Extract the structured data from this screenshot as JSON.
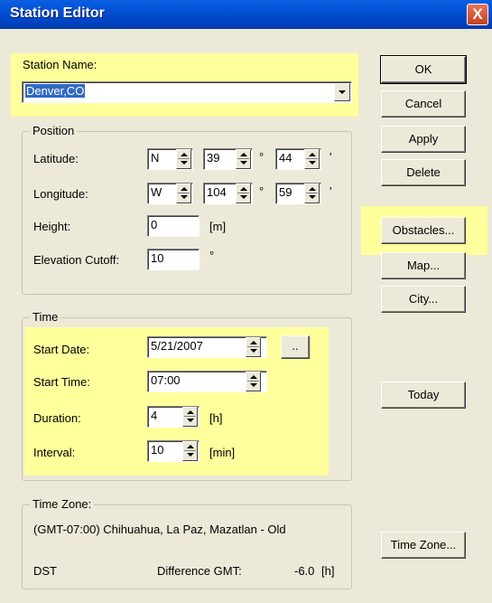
{
  "window": {
    "title": "Station Editor",
    "close_glyph": "X"
  },
  "station": {
    "label": "Station Name:",
    "value": "Denver,CO"
  },
  "position": {
    "legend": "Position",
    "latitude": {
      "label": "Latitude:",
      "hemisphere": "N",
      "degrees": "39",
      "deg_symbol": "°",
      "minutes": "44",
      "min_symbol": "'"
    },
    "longitude": {
      "label": "Longitude:",
      "hemisphere": "W",
      "degrees": "104",
      "deg_symbol": "°",
      "minutes": "59",
      "min_symbol": "'"
    },
    "height": {
      "label": "Height:",
      "value": "0",
      "unit": "[m]"
    },
    "elevation": {
      "label": "Elevation Cutoff:",
      "value": "10",
      "unit": "°"
    }
  },
  "time": {
    "legend": "Time",
    "start_date": {
      "label": "Start Date:",
      "value": "5/21/2007",
      "picker_label": ".."
    },
    "start_time": {
      "label": "Start Time:",
      "value": "07:00"
    },
    "duration": {
      "label": "Duration:",
      "value": "4",
      "unit": "[h]"
    },
    "interval": {
      "label": "Interval:",
      "value": "10",
      "unit": "[min]"
    }
  },
  "timezone": {
    "legend": "Time Zone:",
    "name": "(GMT-07:00) Chihuahua, La Paz, Mazatlan - Old",
    "dst_label": "DST",
    "diff_label": "Difference GMT:",
    "diff_value": "-6.0",
    "diff_unit": "[h]"
  },
  "buttons": {
    "ok": "OK",
    "cancel": "Cancel",
    "apply": "Apply",
    "delete": "Delete",
    "obstacles": "Obstacles...",
    "map": "Map...",
    "city": "City...",
    "today": "Today",
    "timezone": "Time Zone..."
  },
  "colors": {
    "highlight": "#ffff9c",
    "title_bar": "#0453d8",
    "dialog_bg": "#ece9d8",
    "close_button": "#d5542f"
  }
}
